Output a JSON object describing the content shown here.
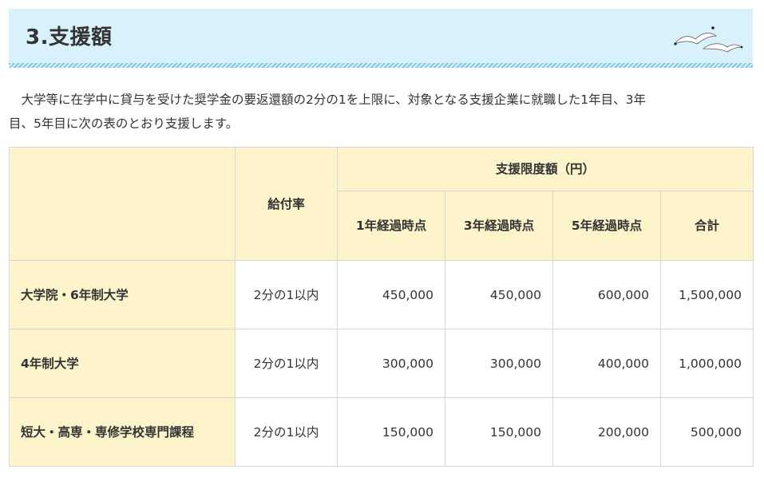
{
  "section": {
    "title": "3.支援額"
  },
  "intro": {
    "text_line1": "大学等に在学中に貸与を受けた奨学金の要返還額の2分の1を上限に、対象となる支援企業に就職した1年目、3年",
    "text_line2": "目、5年目に次の表のとおり支援します。"
  },
  "table": {
    "col_rate_header": "給付率",
    "col_group_header": "支援限度額（円）",
    "sub_headers": [
      "1年経過時点",
      "3年経過時点",
      "5年経過時点",
      "合計"
    ],
    "rows": [
      {
        "name": "大学院・6年制大学",
        "rate": "2分の1以内",
        "y1": "450,000",
        "y3": "450,000",
        "y5": "600,000",
        "total": "1,500,000"
      },
      {
        "name": "4年制大学",
        "rate": "2分の1以内",
        "y1": "300,000",
        "y3": "300,000",
        "y5": "400,000",
        "total": "1,000,000"
      },
      {
        "name": "短大・高専・専修学校専門課程",
        "rate": "2分の1以内",
        "y1": "150,000",
        "y3": "150,000",
        "y5": "200,000",
        "total": "500,000"
      }
    ]
  },
  "colors": {
    "heading_bg": "#d8f1fb",
    "table_header_bg": "#fdf4cc",
    "stripe": "#7fc6ee"
  },
  "icons": {
    "heading_decoration": "seagulls-icon"
  }
}
